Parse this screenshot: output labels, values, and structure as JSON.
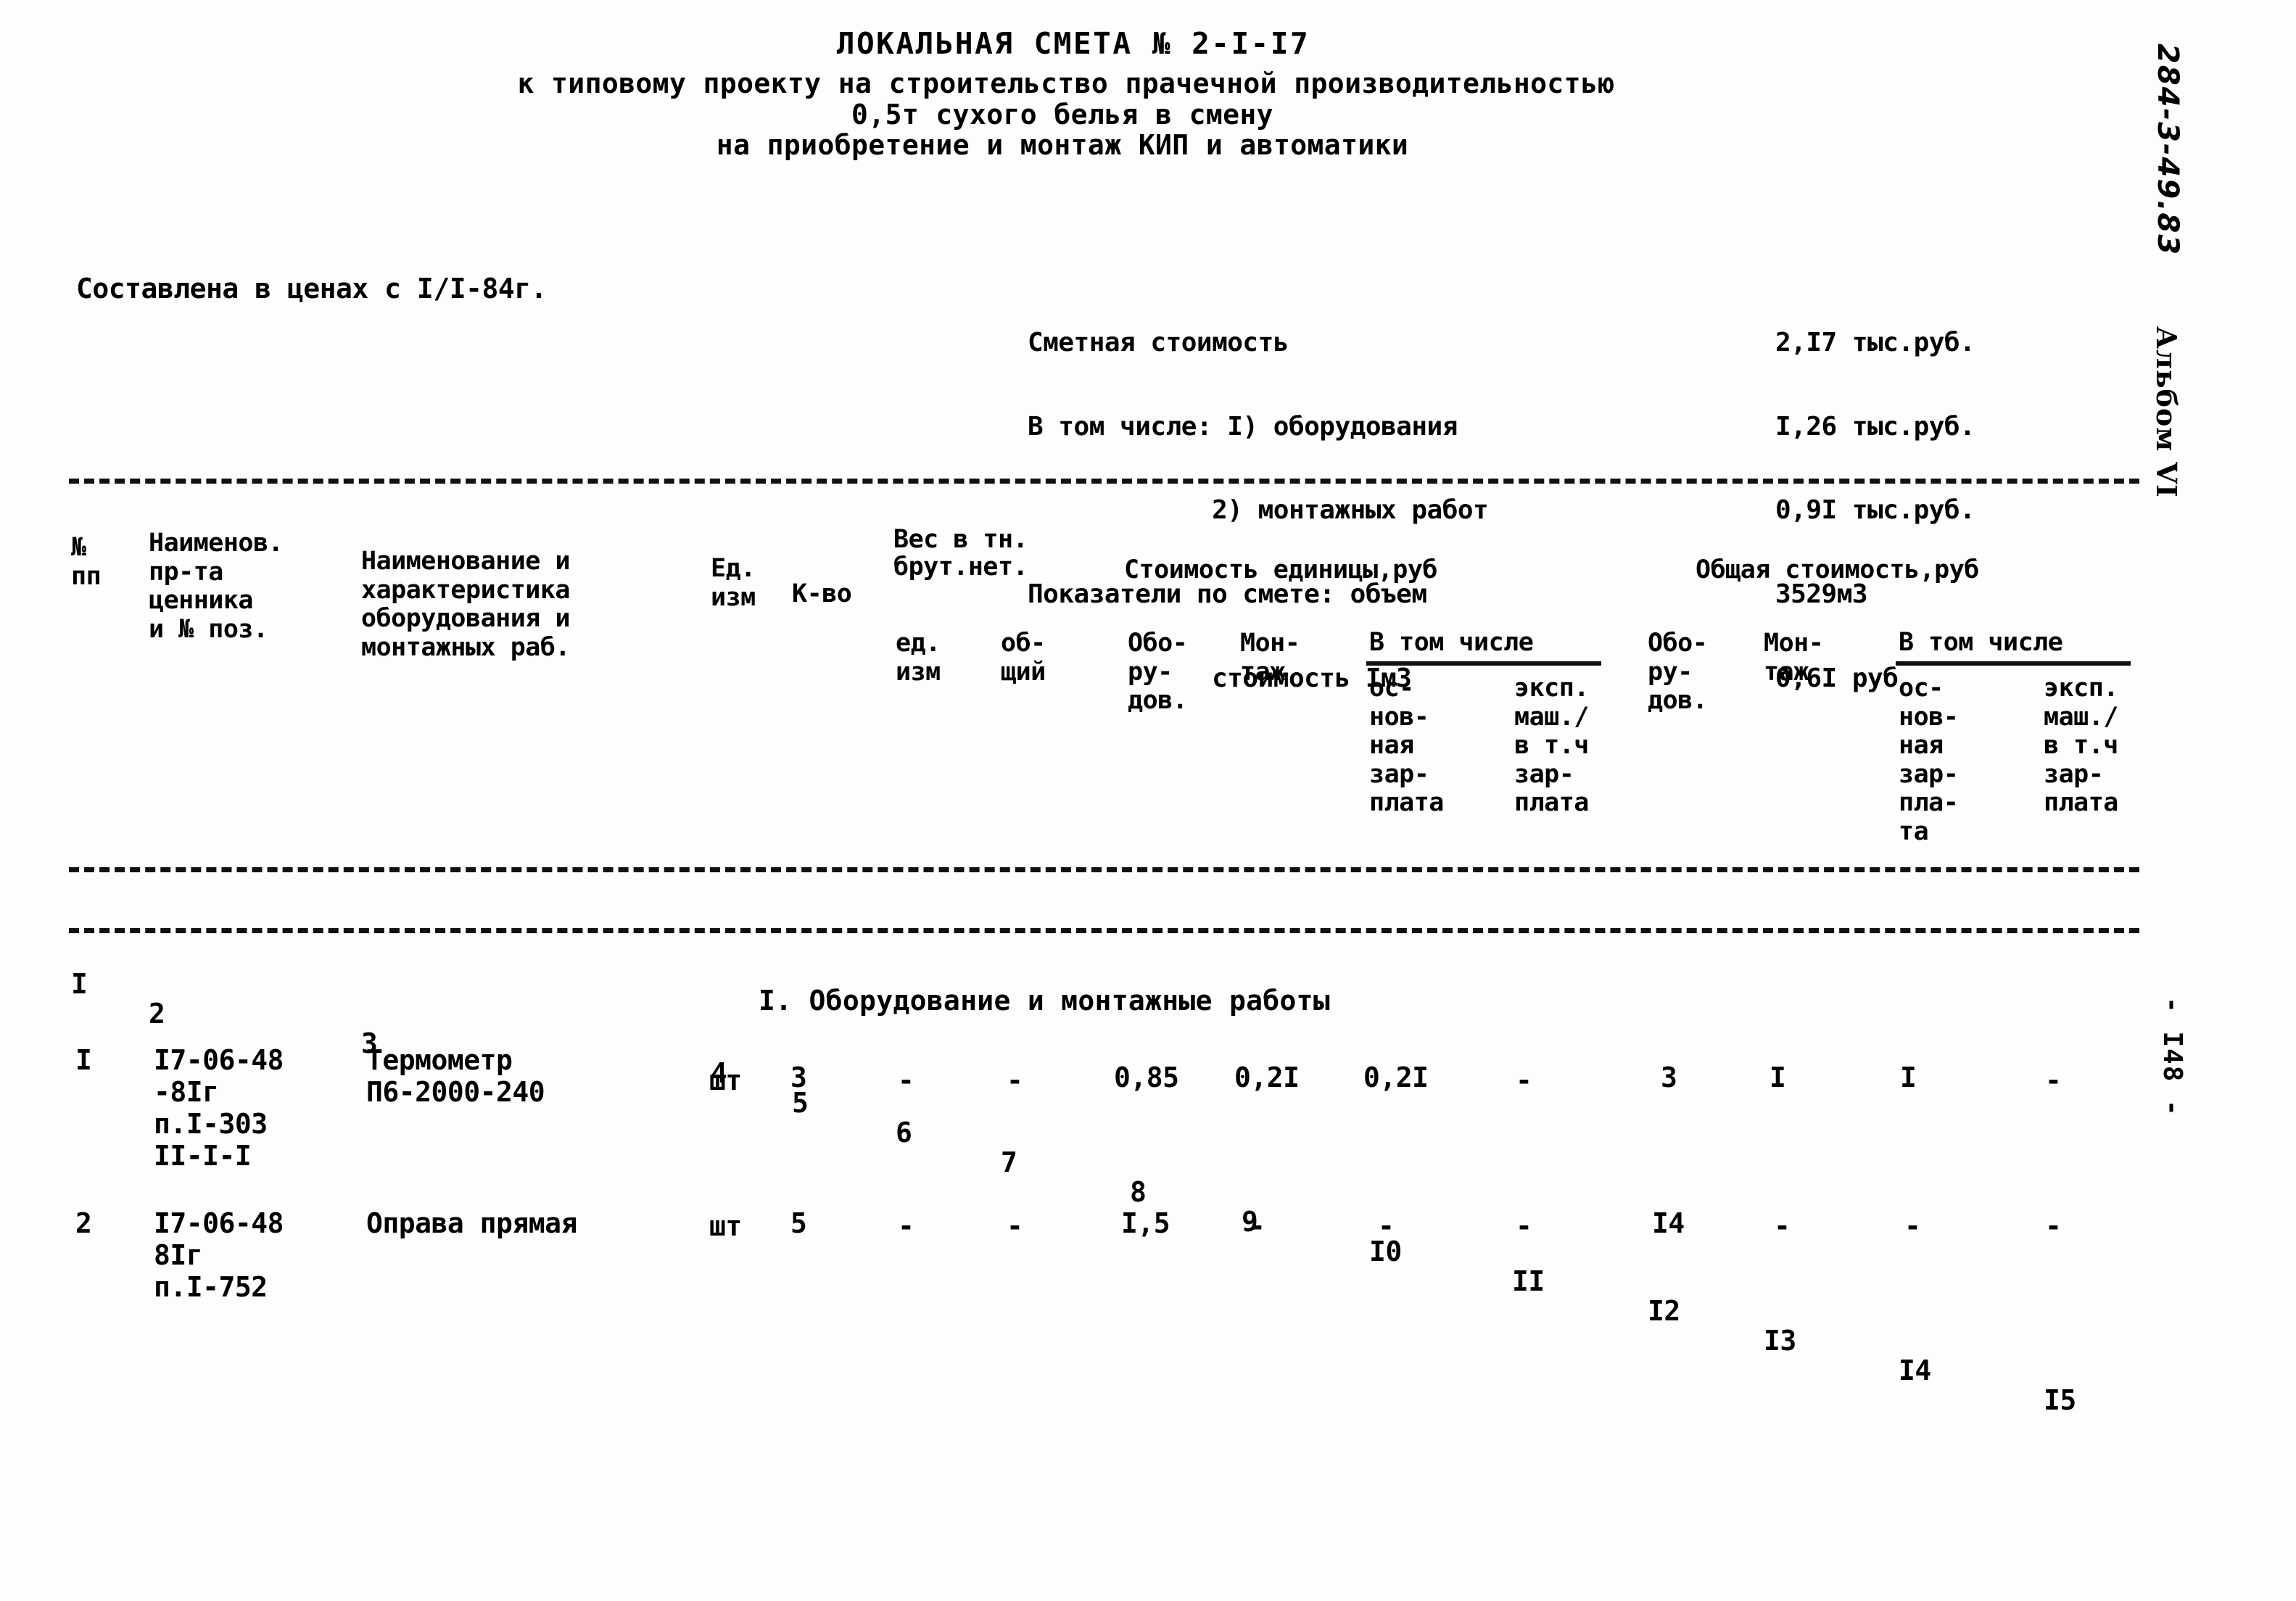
{
  "document": {
    "title": "ЛОКАЛЬНАЯ СМЕТА № 2-I-I7",
    "subtitle_line1": "к типовому проекту на строительство прачечной производительностью",
    "subtitle_line2": "0,5т сухого белья в смену",
    "subtitle_line3": "на приобретение и монтаж КИП и автоматики",
    "prices_note": "Составлена в ценах с I/I-84г.",
    "section_heading": "I. Оборудование и монтажные работы"
  },
  "summary": {
    "rows": [
      {
        "label": "Сметная стоимость",
        "value": "2,I7 тыс.руб."
      },
      {
        "label": "В том числе: I) оборудования",
        "value": "I,26 тыс.руб."
      },
      {
        "label": "            2) монтажных работ",
        "value": "0,9I тыс.руб."
      },
      {
        "label": "Показатели по смете: объем",
        "value": "3529м3"
      },
      {
        "label": "            стоимость Iм3",
        "value": "0,6I руб"
      }
    ]
  },
  "table": {
    "headers": {
      "col1": "№\nпп",
      "col2": "Наименов.\nпр-та\nценника\nи № поз.",
      "col3": "Наименование и\nхарактеристика\nоборудования и\nмонтажных раб.",
      "col4": "Ед.\nизм",
      "col5": "К-во",
      "weight_group": "Вес в тн.\nбрут.нет.",
      "col6": "ед.\nизм",
      "col7": "об-\nщий",
      "unit_cost_group": "Стоимость единицы,руб",
      "col8": "Обо-\nру-\nдов.",
      "col9": "Мон-\nтаж",
      "unit_incl_group": "В том числе",
      "col10": "ос-\nнов-\nная\nзар-\nплата",
      "col11": "эксп.\nмаш./\nв т.ч\nзар-\nплата",
      "total_cost_group": "Общая стоимость,руб",
      "col12": "Обо-\nру-\nдов.",
      "col13": "Мон-\nтаж",
      "total_incl_group": "В том числе",
      "col14": "ос-\nнов-\nная\nзар-\nпла-\nта",
      "col15": "эксп.\nмаш./\nв т.ч\nзар-\nплата"
    },
    "column_numbers": [
      "I",
      "2",
      "3",
      "4",
      "5",
      "6",
      "7",
      "8",
      "9",
      "I0",
      "II",
      "I2",
      "I3",
      "I4",
      "I5"
    ],
    "rows": [
      {
        "num": "I",
        "price_ref": "I7-06-48\n-8Iг\nп.I-303\nII-I-I",
        "name": "Термометр\nП6-2000-240",
        "unit": "шт",
        "qty": "3",
        "weight_unit": "-",
        "weight_total": "-",
        "unit_equipment": "0,85",
        "unit_install": "0,2I",
        "unit_basic_wage": "0,2I",
        "unit_machine_wage": "-",
        "total_equipment": "3",
        "total_install": "I",
        "total_basic_wage": "I",
        "total_machine_wage": "-"
      },
      {
        "num": "2",
        "price_ref": "I7-06-48\n8Iг\nп.I-752",
        "name": "Оправа прямая",
        "unit": "шт",
        "qty": "5",
        "weight_unit": "-",
        "weight_total": "-",
        "unit_equipment": "I,5",
        "unit_install": "-",
        "unit_basic_wage": "-",
        "unit_machine_wage": "-",
        "total_equipment": "I4",
        "total_install": "-",
        "total_basic_wage": "-",
        "total_machine_wage": "-"
      }
    ]
  },
  "margin": {
    "code": "284-3-49.83",
    "album": "Альбом VI",
    "page": "- I48 -"
  }
}
